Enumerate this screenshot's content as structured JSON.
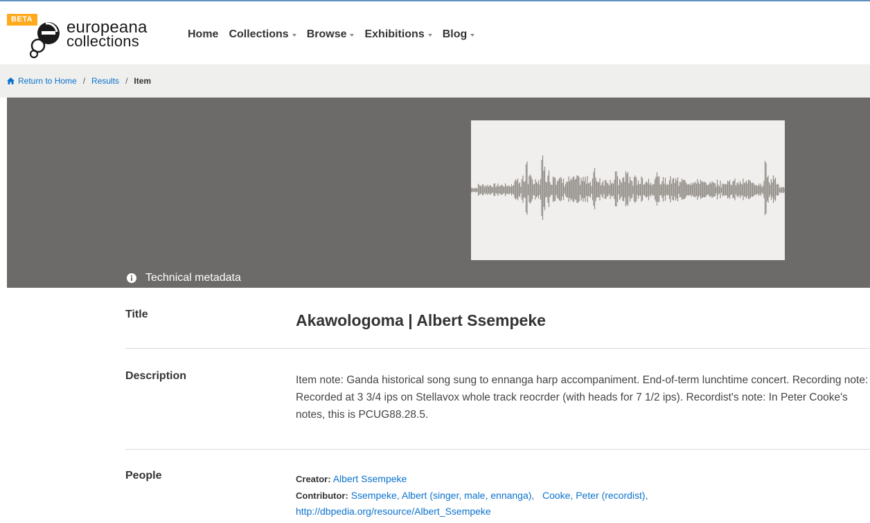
{
  "header": {
    "beta_label": "BETA",
    "logo_line1": "europeana",
    "logo_line2": "collections",
    "nav": [
      {
        "label": "Home",
        "has_caret": false
      },
      {
        "label": "Collections",
        "has_caret": true
      },
      {
        "label": "Browse",
        "has_caret": true
      },
      {
        "label": "Exhibitions",
        "has_caret": true
      },
      {
        "label": "Blog",
        "has_caret": true
      }
    ]
  },
  "breadcrumb": {
    "home": "Return to Home",
    "results": "Results",
    "current": "Item",
    "separator": "/"
  },
  "media": {
    "tech_metadata_label": "Technical metadata",
    "waveform_icon": "audio-waveform-thumbnail"
  },
  "metadata": {
    "title_label": "Title",
    "title_value": "Akawologoma | Albert Ssempeke",
    "description_label": "Description",
    "description_value": "Item note: Ganda historical song sung to ennanga harp accompaniment. End-of-term lunchtime concert. Recording note: Recorded at 3 3/4 ips on Stellavox whole track reocrder (with heads for 7 1/2 ips). Recordist's note: In Peter Cooke's notes, this is PCUG88.28.5.",
    "people_label": "People",
    "creator_label": "Creator:",
    "creator_value": "Albert Ssempeke",
    "contributor_label": "Contributor:",
    "contributors": [
      "Ssempeke, Albert (singer, male, ennanga),",
      "Cooke, Peter (recordist),",
      "http://dbpedia.org/resource/Albert_Ssempeke"
    ]
  },
  "colors": {
    "accent_link": "#0a72cc",
    "beta_badge": "#ffaa1d",
    "media_bg": "#6d6b69",
    "breadcrumb_bg": "#efefed"
  }
}
